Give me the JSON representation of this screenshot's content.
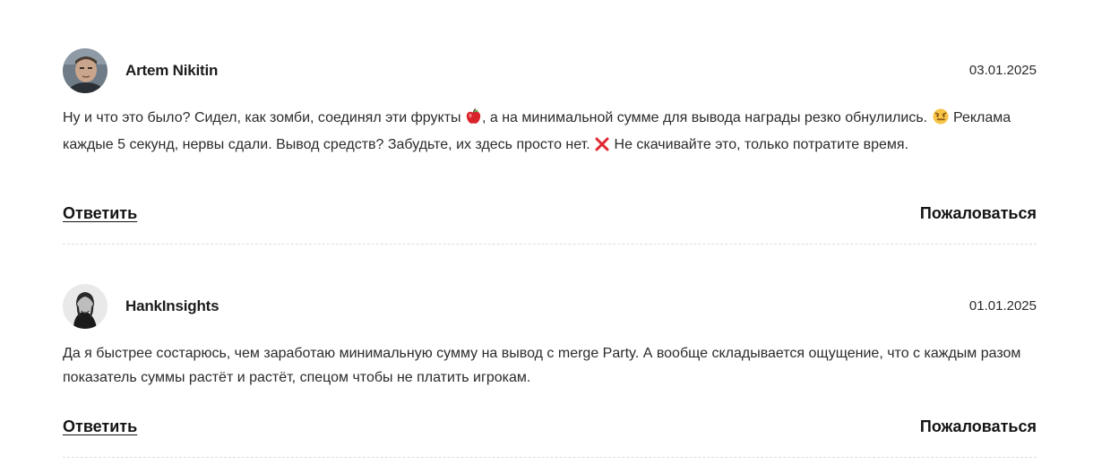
{
  "comments": [
    {
      "author": "Artem Nikitin",
      "date": "03.01.2025",
      "text_parts": [
        "Ну и что это было? Сидел, как зомби, соединял эти фрукты ",
        ", а на минимальной сумме для вывода награды резко обнулились. ",
        " Реклама каждые 5 секунд, нервы сдали. Вывод средств? Забудьте, их здесь просто нет. ",
        " Не скачивайте это, только потратите время."
      ],
      "emojis": [
        "apple-emoji",
        "angry-face-emoji",
        "cross-mark-emoji"
      ],
      "reply_label": "Ответить",
      "report_label": "Пожаловаться"
    },
    {
      "author": "HankInsights",
      "date": "01.01.2025",
      "text": "Да я быстрее состарюсь, чем заработаю минимальную сумму на вывод с merge Party. А вообще складывается ощущение, что с каждым разом показатель суммы растёт и растёт, спецом чтобы не платить игрокам.",
      "reply_label": "Ответить",
      "report_label": "Пожаловаться"
    }
  ],
  "colors": {
    "text": "#2b2b2b",
    "divider": "#dcdcdc",
    "apple": "#d8232a",
    "cross": "#e0262e"
  }
}
